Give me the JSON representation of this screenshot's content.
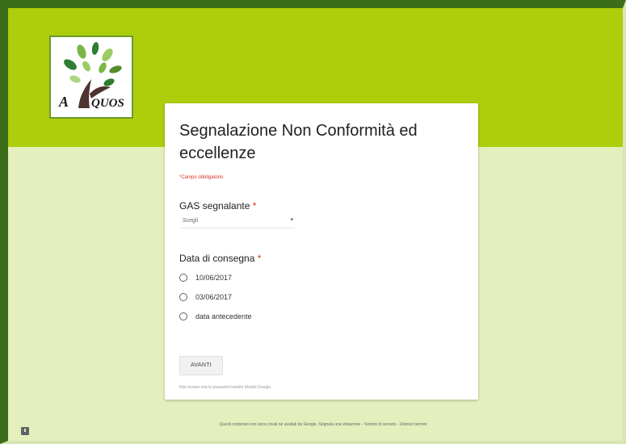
{
  "logo": {
    "text": "A  QUOS"
  },
  "form": {
    "title": "Segnalazione Non Conformità ed eccellenze",
    "required_note": "*Campo obbligatorio",
    "questions": [
      {
        "label": "GAS segnalante",
        "required_mark": "*",
        "select_placeholder": "Scegli",
        "select_chevron": "chevron-down-icon"
      },
      {
        "label": "Data di consegna",
        "required_mark": "*",
        "options": [
          "10/06/2017",
          "03/06/2017",
          "data antecedente"
        ]
      }
    ],
    "next_button": "AVANTI",
    "password_note": "Non inviare mai le password tramite Moduli Google."
  },
  "footer": {
    "text": "Questi contenuti non sono creati né avallati da Google. Segnala una violazione - Termini di servizio - Ulteriori termini"
  },
  "colors": {
    "banner": "#aecd0b",
    "background": "#e3efbc",
    "frame": "#3c6e1a",
    "required": "#d93025"
  }
}
